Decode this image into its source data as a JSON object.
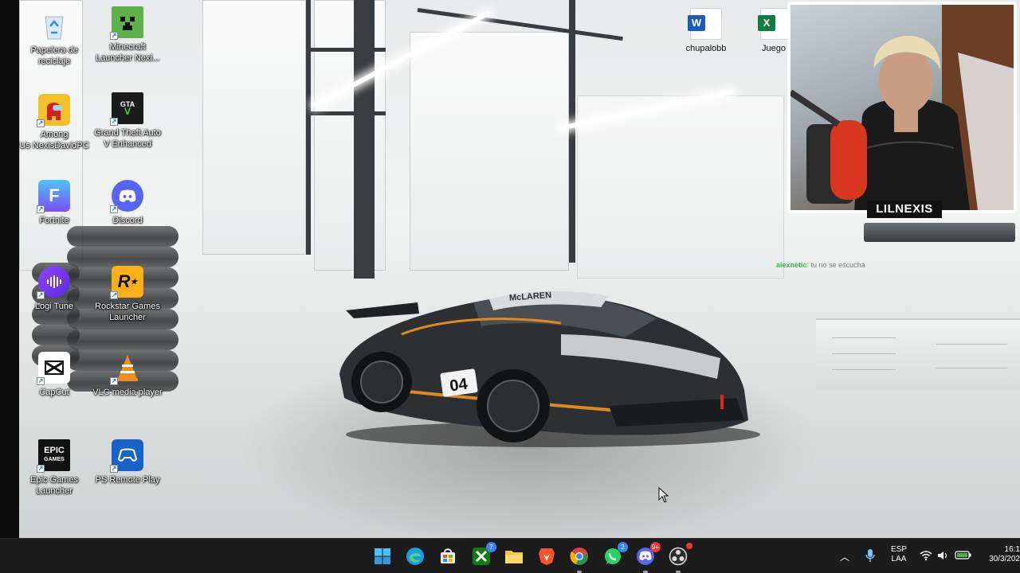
{
  "desktop": {
    "icons": [
      {
        "label": "Papelera de\nreciclaje",
        "icon": "recycle-bin-icon"
      },
      {
        "label": "Minecraft\nLauncher Nexi...",
        "icon": "minecraft-icon"
      },
      {
        "label": "Among\nUs NexisDavidPC",
        "icon": "among-us-icon"
      },
      {
        "label": "Grand Theft Auto\nV Enhanced",
        "icon": "gta-icon"
      },
      {
        "label": "Fortnite",
        "icon": "fortnite-icon"
      },
      {
        "label": "Discord",
        "icon": "discord-icon"
      },
      {
        "label": "Logi Tune",
        "icon": "logi-tune-icon"
      },
      {
        "label": "Rockstar Games\nLauncher",
        "icon": "rockstar-icon"
      },
      {
        "label": "CapCut",
        "icon": "capcut-icon"
      },
      {
        "label": "VLC media player",
        "icon": "vlc-icon"
      },
      {
        "label": "Epic Games\nLauncher",
        "icon": "epic-games-icon"
      },
      {
        "label": "PS Remote Play",
        "icon": "ps-remote-play-icon"
      },
      {
        "label": "chupalobb",
        "icon": "word-document-icon"
      },
      {
        "label": "Juego",
        "icon": "excel-document-icon"
      }
    ],
    "car_number": "04",
    "car_brand": "McLAREN"
  },
  "webcam": {
    "streamer_name": "LILNEXIS",
    "chat_user": "alexnetic",
    "chat_message": "tu no se escucha"
  },
  "taskbar": {
    "apps": [
      {
        "name": "Start",
        "icon": "windows-start-icon",
        "badge": ""
      },
      {
        "name": "Microsoft Edge",
        "icon": "edge-icon",
        "badge": ""
      },
      {
        "name": "Microsoft Store",
        "icon": "store-icon",
        "badge": ""
      },
      {
        "name": "Xbox",
        "icon": "xbox-icon",
        "badge": "7"
      },
      {
        "name": "File Explorer",
        "icon": "folder-icon",
        "badge": ""
      },
      {
        "name": "Brave",
        "icon": "brave-icon",
        "badge": ""
      },
      {
        "name": "Google Chrome",
        "icon": "chrome-icon",
        "badge": ""
      },
      {
        "name": "WhatsApp",
        "icon": "whatsapp-icon",
        "badge": "2"
      },
      {
        "name": "Discord",
        "icon": "discord-icon",
        "badge": "9+"
      },
      {
        "name": "OBS Studio",
        "icon": "obs-icon",
        "badge": ""
      }
    ],
    "tray": {
      "language_top": "ESP",
      "language_bottom": "LAA",
      "time": "16:1",
      "date": "30/3/202"
    }
  },
  "colors": {
    "taskbar_bg": "#1c1c1c",
    "accent": "#3b82f6",
    "label_text": "#ffffff"
  }
}
